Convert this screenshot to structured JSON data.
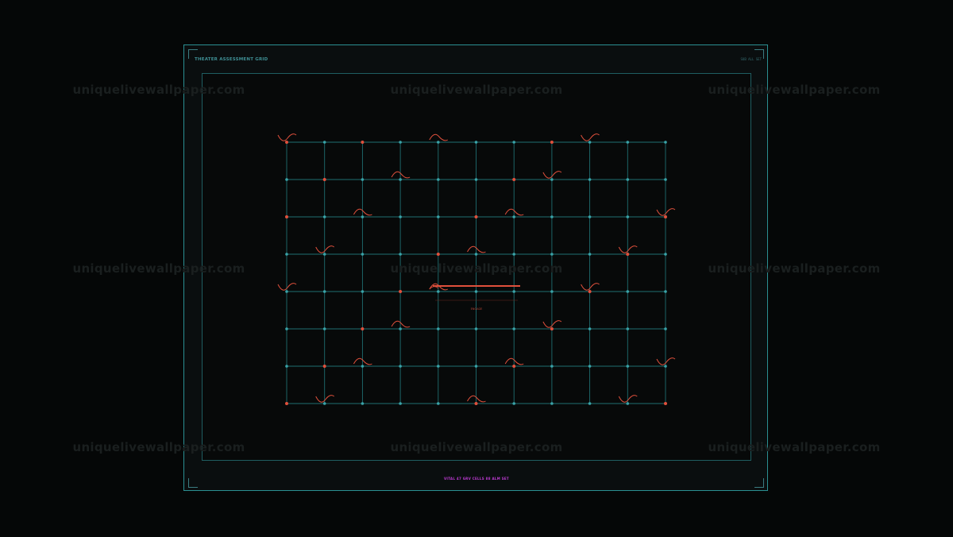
{
  "header": {
    "title": "THEATER ASSESSMENT GRID",
    "meta": "SUB ALL SET"
  },
  "grid": {
    "center_label": "ENGAGE",
    "rows": 8,
    "cols": 11,
    "node_states": [
      [
        "alert",
        "normal",
        "alert",
        "normal",
        "normal",
        "normal",
        "normal",
        "alert",
        "normal",
        "normal",
        "normal"
      ],
      [
        "normal",
        "alert",
        "normal",
        "normal",
        "normal",
        "normal",
        "alert",
        "normal",
        "normal",
        "normal",
        "normal"
      ],
      [
        "alert",
        "normal",
        "normal",
        "normal",
        "normal",
        "alert",
        "normal",
        "normal",
        "normal",
        "normal",
        "alert"
      ],
      [
        "normal",
        "normal",
        "normal",
        "normal",
        "alert",
        "normal",
        "normal",
        "normal",
        "normal",
        "alert",
        "normal"
      ],
      [
        "normal",
        "normal",
        "normal",
        "alert",
        "normal",
        "normal",
        "normal",
        "normal",
        "alert",
        "normal",
        "normal"
      ],
      [
        "normal",
        "normal",
        "alert",
        "normal",
        "normal",
        "normal",
        "normal",
        "alert",
        "normal",
        "normal",
        "normal"
      ],
      [
        "normal",
        "alert",
        "normal",
        "normal",
        "normal",
        "normal",
        "alert",
        "normal",
        "normal",
        "normal",
        "normal"
      ],
      [
        "alert",
        "normal",
        "normal",
        "normal",
        "normal",
        "alert",
        "normal",
        "normal",
        "normal",
        "normal",
        "alert"
      ]
    ]
  },
  "footer": {
    "status": "VITAL 47 GRV CELLS 88 ALM SET"
  },
  "watermarks": [
    "uniquelivewallpaper.com",
    "uniquelivewallpaper.com",
    "uniquelivewallpaper.com",
    "uniquelivewallpaper.com",
    "uniquelivewallpaper.com",
    "uniquelivewallpaper.com",
    "uniquelivewallpaper.com",
    "uniquelivewallpaper.com",
    "uniquelivewallpaper.com"
  ],
  "colors": {
    "frame": "#2b8f92",
    "grid_line": "#1f6e71",
    "node": "#3aa3a8",
    "alert": "#e0503c",
    "status": "#c03bd6"
  }
}
